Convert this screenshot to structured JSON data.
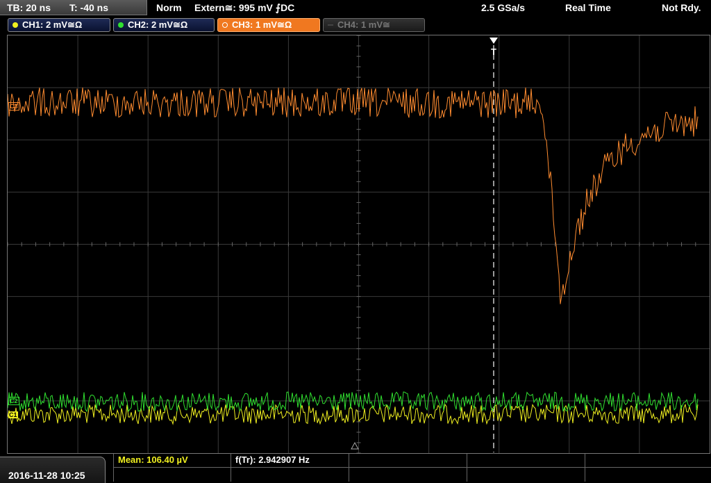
{
  "header": {
    "timebase": "TB: 20 ns",
    "time_offset": "T: -40 ns",
    "acq_mode": "Norm",
    "trigger": "Extern≅: 995 mV ⨍DC",
    "sample_rate": "2.5 GSa/s",
    "acq_type": "Real Time",
    "status": "Not Rdy."
  },
  "channels": [
    {
      "label": "CH1: 2 mV≅Ω",
      "color": "#f0f020",
      "state": "on"
    },
    {
      "label": "CH2: 2 mV≅Ω",
      "color": "#30e030",
      "state": "on"
    },
    {
      "label": "CH3: 1 mV≅Ω",
      "color": "#ff8c30",
      "state": "active"
    },
    {
      "label": "CH4: 1 mV≅",
      "color": "#777777",
      "state": "off"
    }
  ],
  "markers": {
    "ch3": "C3",
    "ch2": "C2",
    "ch1": "C1",
    "trigger": "T"
  },
  "colors": {
    "ch1": "#f0f020",
    "ch2": "#30e030",
    "ch3": "#ff8c30",
    "grid": "#3a3a3a"
  },
  "footer": {
    "datetime": "2016-11-28 10:25",
    "measurements": [
      {
        "label": "Mean: 106.40 µV",
        "color": "#f0f020"
      },
      {
        "label": "f(Tr): 2.942907 Hz",
        "color": "#ffffff"
      }
    ]
  }
}
